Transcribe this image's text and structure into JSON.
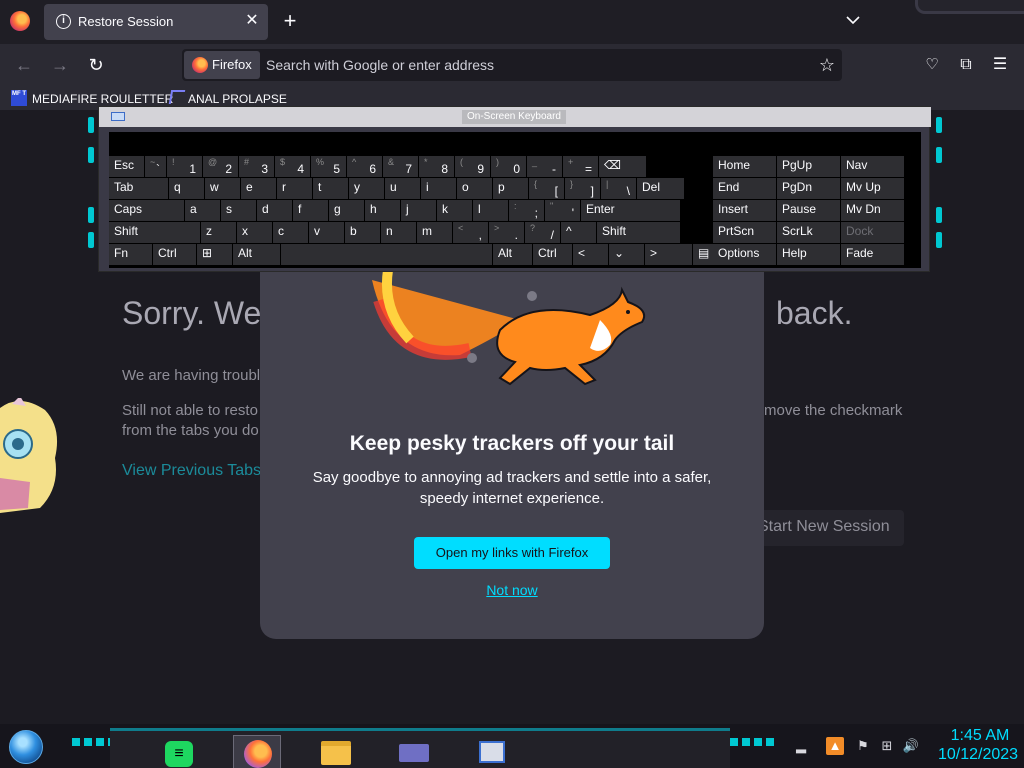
{
  "browser": {
    "tab": {
      "title": "Restore Session",
      "close_symbol": "✕"
    },
    "new_tab_symbol": "+",
    "tab_list_symbol": "⌄",
    "nav": {
      "back": "←",
      "forward": "→",
      "reload": "↻"
    },
    "identity_label": "Firefox",
    "url_placeholder": "Search with Google or enter address",
    "star_symbol": "☆",
    "pocket_symbol": "♡",
    "extensions_symbol": "⧉",
    "menu_symbol": "☰",
    "bookmarks": [
      {
        "label": "MEDIAFIRE ROULETTER",
        "icon": "mediafire-icon",
        "icon_text": "MF T"
      },
      {
        "label": "ANAL PROLAPSE",
        "icon": "bookmark-site-icon"
      }
    ]
  },
  "restore_page": {
    "title_left": "Sorry. We’",
    "title_right": "back.",
    "having_trouble": "We are having troubl",
    "still_not": "Still not able to resto",
    "move_checkmark": "move the checkmark",
    "from_tabs": "from the tabs you do",
    "view_previous": "View Previous Tabs",
    "start_new_session": "Start New Session"
  },
  "modal": {
    "title": "Keep pesky trackers off your tail",
    "body": "Say goodbye to annoying ad trackers and settle into a safer, speedy internet experience.",
    "primary_button": "Open my links with Firefox",
    "secondary_link": "Not now"
  },
  "osk": {
    "title": "On-Screen Keyboard",
    "rows": [
      [
        {
          "main": "Esc"
        },
        {
          "shift": "~",
          "main": "`"
        },
        {
          "shift": "!",
          "main": "1"
        },
        {
          "shift": "@",
          "main": "2"
        },
        {
          "shift": "#",
          "main": "3"
        },
        {
          "shift": "$",
          "main": "4"
        },
        {
          "shift": "%",
          "main": "5"
        },
        {
          "shift": "^",
          "main": "6"
        },
        {
          "shift": "&",
          "main": "7"
        },
        {
          "shift": "*",
          "main": "8"
        },
        {
          "shift": "(",
          "main": "9"
        },
        {
          "shift": ")",
          "main": "0"
        },
        {
          "shift": "_",
          "main": "-"
        },
        {
          "shift": "+",
          "main": "="
        },
        {
          "main": "⌫"
        },
        {
          "main": "Home"
        },
        {
          "main": "PgUp"
        },
        {
          "main": "Nav"
        }
      ],
      [
        {
          "main": "Tab"
        },
        {
          "main": "q"
        },
        {
          "main": "w"
        },
        {
          "main": "e"
        },
        {
          "main": "r"
        },
        {
          "main": "t"
        },
        {
          "main": "y"
        },
        {
          "main": "u"
        },
        {
          "main": "i"
        },
        {
          "main": "o"
        },
        {
          "main": "p"
        },
        {
          "shift": "{",
          "main": "["
        },
        {
          "shift": "}",
          "main": "]"
        },
        {
          "shift": "|",
          "main": "\\"
        },
        {
          "main": "Del"
        },
        {
          "main": "End"
        },
        {
          "main": "PgDn"
        },
        {
          "main": "Mv Up"
        }
      ],
      [
        {
          "main": "Caps"
        },
        {
          "main": "a"
        },
        {
          "main": "s"
        },
        {
          "main": "d"
        },
        {
          "main": "f"
        },
        {
          "main": "g"
        },
        {
          "main": "h"
        },
        {
          "main": "j"
        },
        {
          "main": "k"
        },
        {
          "main": "l"
        },
        {
          "shift": ":",
          "main": ";"
        },
        {
          "shift": "\"",
          "main": "'"
        },
        {
          "main": "Enter"
        },
        {
          "main": "Insert"
        },
        {
          "main": "Pause"
        },
        {
          "main": "Mv Dn"
        }
      ],
      [
        {
          "main": "Shift"
        },
        {
          "main": "z"
        },
        {
          "main": "x"
        },
        {
          "main": "c"
        },
        {
          "main": "v"
        },
        {
          "main": "b"
        },
        {
          "main": "n"
        },
        {
          "main": "m"
        },
        {
          "shift": "<",
          "main": ","
        },
        {
          "shift": ">",
          "main": "."
        },
        {
          "shift": "?",
          "main": "/"
        },
        {
          "main": "^"
        },
        {
          "main": "Shift"
        },
        {
          "main": "PrtScn"
        },
        {
          "main": "ScrLk"
        },
        {
          "main": "Dock",
          "dim": true
        }
      ],
      [
        {
          "main": "Fn"
        },
        {
          "main": "Ctrl"
        },
        {
          "main": "⊞"
        },
        {
          "main": "Alt"
        },
        {
          "main": ""
        },
        {
          "main": "Alt"
        },
        {
          "main": "Ctrl"
        },
        {
          "main": "<"
        },
        {
          "main": "⌄"
        },
        {
          "main": ">"
        },
        {
          "main": "▤"
        },
        {
          "main": "Options"
        },
        {
          "main": "Help"
        },
        {
          "main": "Fade"
        }
      ]
    ]
  },
  "taskbar": {
    "apps": [
      {
        "name": "spotify",
        "glyph": "≡"
      },
      {
        "name": "firefox"
      },
      {
        "name": "file-explorer"
      },
      {
        "name": "app-card"
      },
      {
        "name": "on-screen-keyboard"
      }
    ],
    "tray": {
      "show_hidden": "▂",
      "flag": "⚑",
      "network": "⊞",
      "volume": "🔊",
      "time": "1:45 AM",
      "date": "10/12/2023"
    }
  }
}
